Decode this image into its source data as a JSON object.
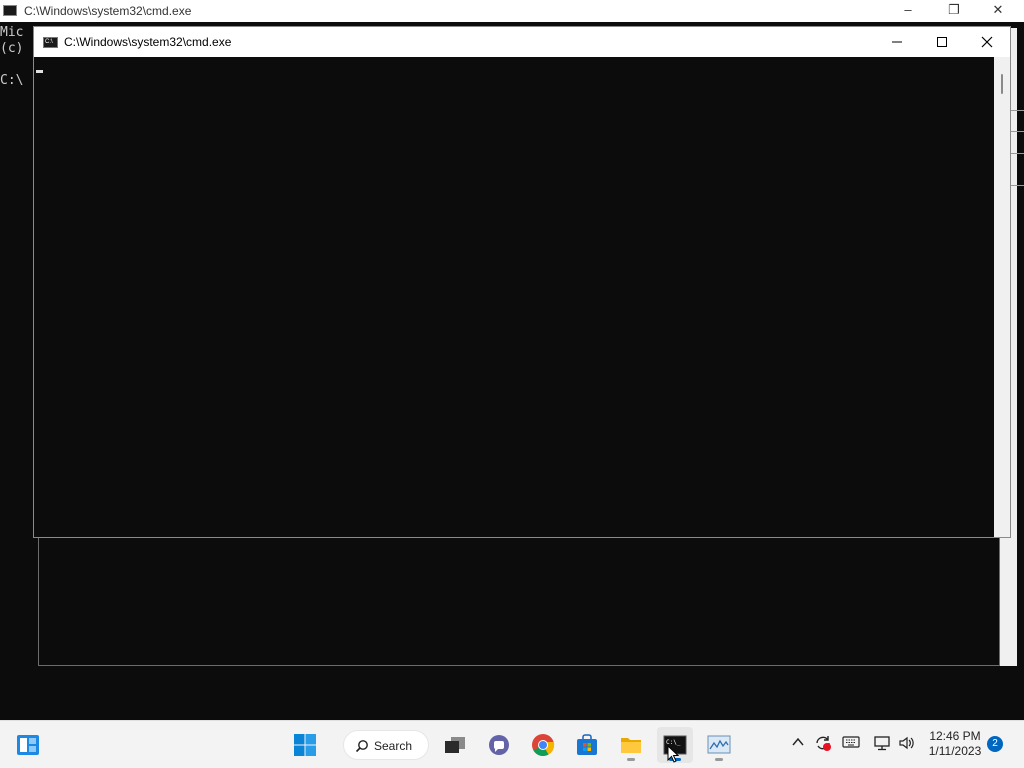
{
  "background_window": {
    "title": "C:\\Windows\\system32\\cmd.exe",
    "lines": [
      "Mic",
      "(c)",
      "",
      "C:\\"
    ]
  },
  "foreground_window": {
    "title": "C:\\Windows\\system32\\cmd.exe",
    "minimize_icon": "minimize-icon",
    "maximize_icon": "maximize-icon",
    "close_icon": "close-icon",
    "console_text": ""
  },
  "taskbar": {
    "widgets_icon": "widgets-icon",
    "start_icon": "windows-start-icon",
    "search_label": "Search",
    "apps": [
      {
        "name": "task-view-icon",
        "running": false
      },
      {
        "name": "teams-chat-icon",
        "running": false
      },
      {
        "name": "chrome-icon",
        "running": false
      },
      {
        "name": "microsoft-store-icon",
        "running": false
      },
      {
        "name": "file-explorer-icon",
        "running": true
      },
      {
        "name": "command-prompt-icon",
        "running": true,
        "active": true
      },
      {
        "name": "performance-monitor-icon",
        "running": true
      }
    ],
    "tray": {
      "clock_time": "12:46 PM",
      "clock_date": "1/11/2023",
      "notification_count": "2"
    }
  },
  "colors": {
    "console_bg": "#0c0c0c",
    "accent": "#0067c0",
    "taskbar_bg": "#f3f3f3"
  }
}
